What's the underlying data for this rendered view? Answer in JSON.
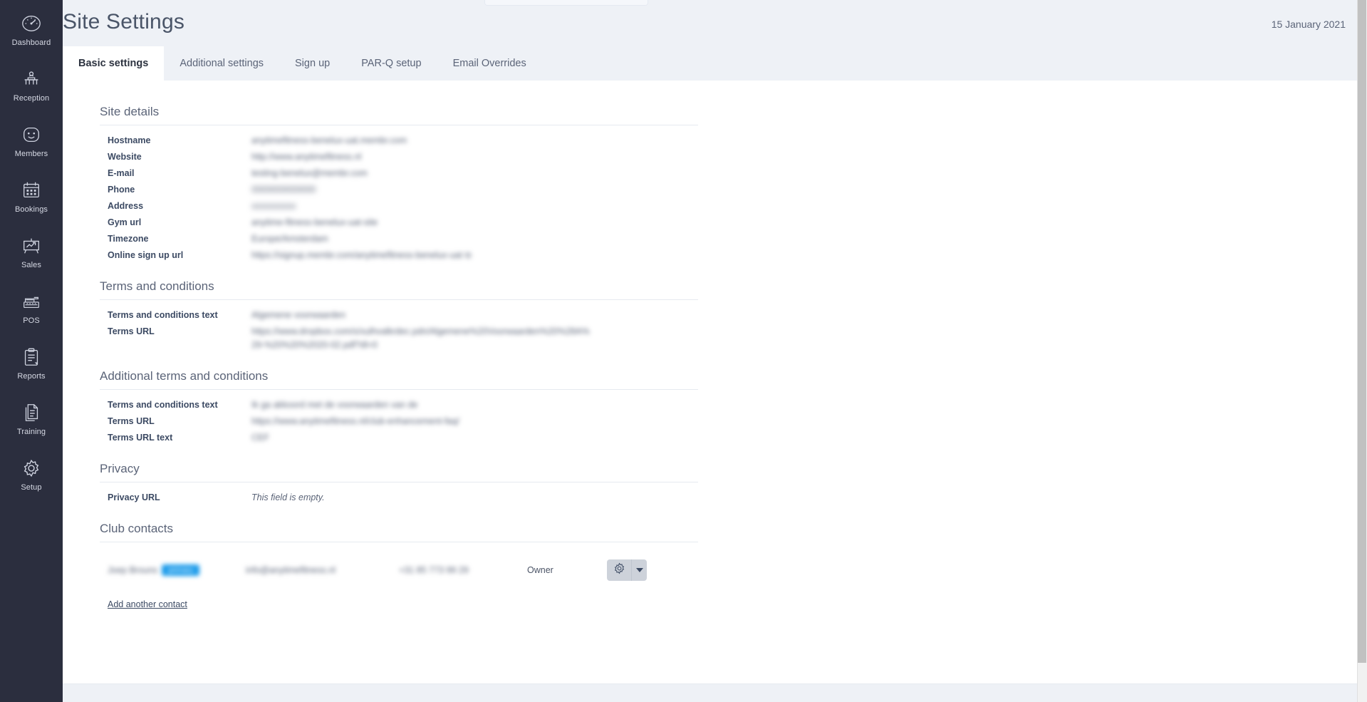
{
  "sidebar": {
    "items": [
      {
        "label": "Dashboard",
        "icon": "gauge-icon"
      },
      {
        "label": "Reception",
        "icon": "reception-desk-icon"
      },
      {
        "label": "Members",
        "icon": "smiley-face-icon"
      },
      {
        "label": "Bookings",
        "icon": "calendar-icon"
      },
      {
        "label": "Sales",
        "icon": "chart-easel-icon"
      },
      {
        "label": "POS",
        "icon": "cash-register-icon"
      },
      {
        "label": "Reports",
        "icon": "clipboard-icon"
      },
      {
        "label": "Training",
        "icon": "documents-icon"
      },
      {
        "label": "Setup",
        "icon": "gear-icon"
      }
    ]
  },
  "header": {
    "title": "Site Settings",
    "date": "15 January 2021"
  },
  "tabs": [
    {
      "label": "Basic settings",
      "active": true
    },
    {
      "label": "Additional settings",
      "active": false
    },
    {
      "label": "Sign up",
      "active": false
    },
    {
      "label": "PAR-Q setup",
      "active": false
    },
    {
      "label": "Email Overrides",
      "active": false
    }
  ],
  "sections": {
    "site_details": {
      "heading": "Site details",
      "rows": [
        {
          "label": "Hostname",
          "value": "anytimefitness-benelux-uat.membr.com",
          "redacted": true
        },
        {
          "label": "Website",
          "value": "http://www.anytimefitness.nl",
          "redacted": true
        },
        {
          "label": "E-mail",
          "value": "testing-benelux@membr.com",
          "redacted": true
        },
        {
          "label": "Phone",
          "value": "0000000000000",
          "redacted": true
        },
        {
          "label": "Address",
          "value": "xxxxxxxxxx",
          "redacted": true
        },
        {
          "label": "Gym url",
          "value": "anytime-fitness-benelux-uat-site",
          "redacted": true
        },
        {
          "label": "Timezone",
          "value": "Europe/Amsterdam",
          "redacted": true
        },
        {
          "label": "Online sign up url",
          "value": "https://signup.membr.com/anytimefitness-benelux-uat ⧉",
          "redacted": true
        }
      ]
    },
    "terms": {
      "heading": "Terms and conditions",
      "rows": [
        {
          "label": "Terms and conditions text",
          "value": "Algemene voorwaarden",
          "redacted": true
        },
        {
          "label": "Terms URL",
          "value": "https://www.dropbox.com/s/xulhvalkrdec.pdn/Algemene%20Voorwaarden%20%28A%29-%20%20%2020-02.pdf?dl=0",
          "redacted": true
        }
      ]
    },
    "additional_terms": {
      "heading": "Additional terms and conditions",
      "rows": [
        {
          "label": "Terms and conditions text",
          "value": "Ik ga akkoord met de voorwaarden van de",
          "redacted": true
        },
        {
          "label": "Terms URL",
          "value": "https://www.anytimefitness.nl/club-enhancement-faq/",
          "redacted": true
        },
        {
          "label": "Terms URL text",
          "value": "CEF",
          "redacted": true
        }
      ]
    },
    "privacy": {
      "heading": "Privacy",
      "rows": [
        {
          "label": "Privacy URL",
          "value": "This field is empty.",
          "redacted": false,
          "italic": true
        }
      ]
    },
    "club_contacts": {
      "heading": "Club contacts",
      "contact": {
        "name": "Joep Brouns",
        "badge": "primary",
        "email": "info@anytimefitness.nl",
        "phone": "+31 85 773 99 29",
        "role": "Owner",
        "gear_icon": "gear-icon",
        "caret_icon": "chevron-down-icon"
      },
      "add_link": "Add another contact"
    }
  },
  "colors": {
    "sidebar_bg": "#2b2e3e",
    "page_bg": "#eef1f6",
    "card_bg": "#ffffff",
    "badge_blue": "#1b9bea",
    "label_text": "#3c4a63",
    "muted_text": "#5b6478"
  }
}
